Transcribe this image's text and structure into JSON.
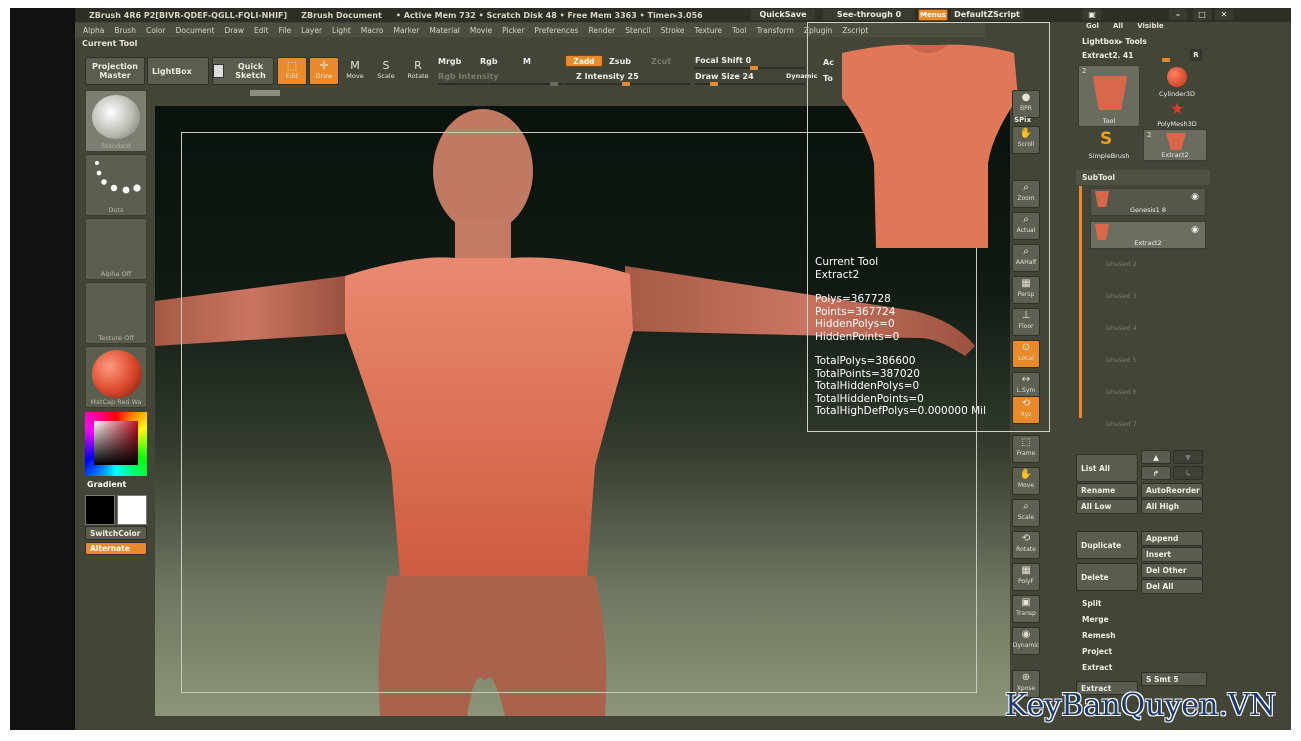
{
  "titlebar": {
    "app": "ZBrush 4R6  P2[BIVR-QDEF-QGLL-FQLI-NHIF]",
    "document": "ZBrush Document",
    "stats": "• Active Mem 732 • Scratch Disk 48 • Free Mem 3363 • Timer▸3.056",
    "quicksave": "QuickSave",
    "see_through": "See-through  0",
    "menus": "Menus",
    "script": "DefaultZScript"
  },
  "menubar": [
    "Alpha",
    "Brush",
    "Color",
    "Document",
    "Draw",
    "Edit",
    "File",
    "Layer",
    "Light",
    "Macro",
    "Marker",
    "Material",
    "Movie",
    "Picker",
    "Preferences",
    "Render",
    "Stencil",
    "Stroke",
    "Texture",
    "Tool",
    "Transform",
    "Zplugin",
    "Zscript"
  ],
  "palette_title": "Current Tool",
  "toolbar": {
    "projection_master": "Projection Master",
    "lightbox": "LightBox",
    "quick_sketch": "Quick Sketch",
    "edit": "Edit",
    "draw": "Draw",
    "move": "Move",
    "scale": "Scale",
    "rotate": "Rotate",
    "mrgb": "Mrgb",
    "rgb": "Rgb",
    "m": "M",
    "zadd": "Zadd",
    "zsub": "Zsub",
    "zcut": "Zcut",
    "rgb_intensity": "Rgb Intensity",
    "z_intensity": "Z Intensity 25",
    "focal_shift": "Focal Shift 0",
    "draw_size": "Draw Size 24",
    "dynamic": "Dynamic",
    "ac": "Ac",
    "to": "To"
  },
  "left_shelf": {
    "brush": "Standard",
    "stroke": "Dots",
    "alpha": "Alpha  Off",
    "texture": "Texture  Off",
    "material": "MatCap Red Wa",
    "gradient": "Gradient",
    "switch_color": "SwitchColor",
    "alternate": "Alternate"
  },
  "info": {
    "current_tool_label": "Current Tool",
    "tool_name": "Extract2",
    "polys": "Polys=367728",
    "points": "Points=367724",
    "hidden_polys": "HiddenPolys=0",
    "hidden_points": "HiddenPoints=0",
    "total_polys": "TotalPolys=386600",
    "total_points": "TotalPoints=387020",
    "total_hidden_polys": "TotalHiddenPolys=0",
    "total_hidden_points": "TotalHiddenPoints=0",
    "total_highdef": "TotalHighDefPolys=0.000000 Mil"
  },
  "right_shelf": [
    "BPR",
    "SPix",
    "Scroll",
    "Zoom",
    "Actual",
    "AAHalf",
    "Persp",
    "Floor",
    "Local",
    "L.Sym",
    "Xyz",
    "Frame",
    "Move",
    "Scale",
    "Rotate",
    "PolyF",
    "Transp",
    "Dynamic",
    "Xpose"
  ],
  "tool_palette": {
    "top_labels": [
      "Gol",
      "All",
      "Visible"
    ],
    "header": "Lightbox▸ Tools",
    "current": "Extract2. 41",
    "r_label": "R",
    "tool_count": "2",
    "tool_label": "Tool",
    "cylinder": "Cylinder3D",
    "polymesh": "PolyMesh3D",
    "simplebrush": "SimpleBrush",
    "extract_count": "2",
    "extract_label": "Extract2"
  },
  "subtool": {
    "header": "SubTool",
    "items": [
      {
        "name": "Genesis1 8"
      },
      {
        "name": "Extract2"
      },
      {
        "name": "Unused  2"
      },
      {
        "name": "Unused  3"
      },
      {
        "name": "Unused  4"
      },
      {
        "name": "Unused  5"
      },
      {
        "name": "Unused  6"
      },
      {
        "name": "Unused  7"
      }
    ],
    "list_all": "List All",
    "rename": "Rename",
    "auto_reorder": "AutoReorder",
    "all_low": "All Low",
    "all_high": "All High",
    "duplicate": "Duplicate",
    "append": "Append",
    "insert": "Insert",
    "delete": "Delete",
    "del_other": "Del Other",
    "del_all": "Del All",
    "split": "Split",
    "merge": "Merge",
    "remesh": "Remesh",
    "project": "Project",
    "extract": "Extract",
    "s_smt": "S Smt 5",
    "extract_btn": "Extract"
  },
  "watermark": "KeyBanQuyen.VN",
  "colors": {
    "accent": "#e98b2a",
    "skin": "#d8684c",
    "panel": "#434538"
  }
}
